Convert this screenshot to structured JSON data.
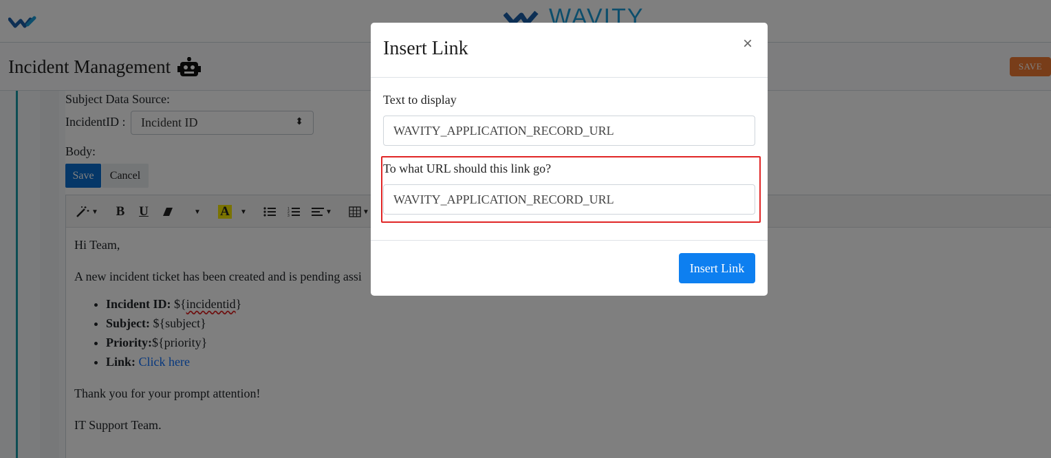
{
  "header": {
    "brand_name": "WAVITY",
    "brand_color": "#1a9dd9"
  },
  "titlebar": {
    "title": "Incident Management",
    "save_label": "SAVE",
    "save_color": "#f07a32"
  },
  "form": {
    "subject_source_label": "Subject Data Source:",
    "incident_id_label": "IncidentID :",
    "incident_id_selected": "Incident ID",
    "body_label": "Body:",
    "save_label": "Save",
    "cancel_label": "Cancel"
  },
  "editor": {
    "toolbar_icons": [
      "magic-wand-icon",
      "bold-icon",
      "underline-icon",
      "eraser-icon",
      "font-color-icon",
      "unordered-list-icon",
      "ordered-list-icon",
      "align-icon",
      "table-icon"
    ],
    "bold_glyph": "B",
    "underline_glyph": "U",
    "font_color_glyph": "A",
    "greeting": "Hi Team,",
    "intro": "A new incident ticket has been created and is pending assi",
    "items": [
      {
        "label": "Incident ID:",
        "value": " ${",
        "value_squiggle": "incidentid",
        "value_end": "}"
      },
      {
        "label": "Subject:",
        "value": " ${subject}"
      },
      {
        "label": "Priority:",
        "value": "${priority}"
      },
      {
        "label": "Link:",
        "link_text": "Click here"
      }
    ],
    "thanks": "Thank you for your prompt attention!",
    "signature": "IT Support Team."
  },
  "modal": {
    "title": "Insert Link",
    "close_glyph": "×",
    "text_label": "Text to display",
    "text_value": "WAVITY_APPLICATION_RECORD_URL",
    "url_label": "To what URL should this link go?",
    "url_value": "WAVITY_APPLICATION_RECORD_URL",
    "insert_label": "Insert Link",
    "highlight_color": "#e02424"
  }
}
